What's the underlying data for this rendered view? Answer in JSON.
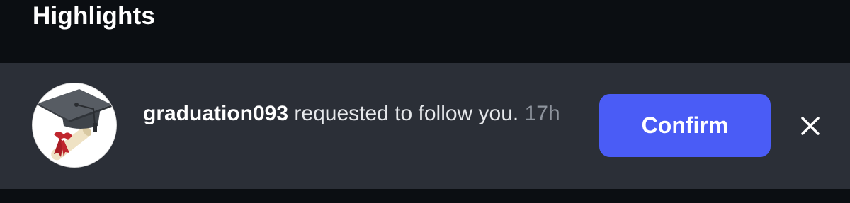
{
  "section": {
    "title": "Highlights"
  },
  "notification": {
    "avatar_icon": "graduation-cap-diploma-icon",
    "username": "graduation093",
    "message": " requested to follow you. ",
    "timestamp": "17h",
    "confirm_label": "Confirm",
    "dismiss_icon": "close-icon"
  },
  "colors": {
    "background": "#0b0e12",
    "row_background": "#2b2f37",
    "accent": "#4a5cf6",
    "text_primary": "#ffffff",
    "text_secondary": "#8e949d"
  }
}
